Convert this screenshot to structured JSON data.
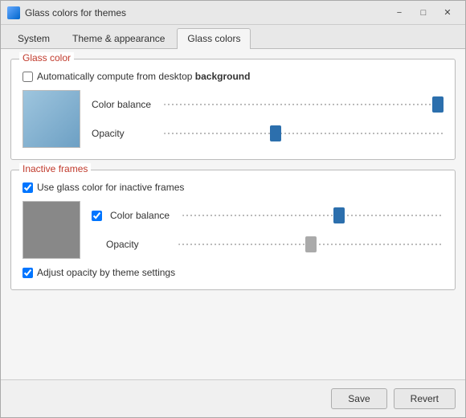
{
  "window": {
    "title": "Glass colors for themes",
    "icon": "app-icon"
  },
  "titlebar": {
    "minimize_label": "−",
    "maximize_label": "□",
    "close_label": "✕"
  },
  "tabs": [
    {
      "id": "system",
      "label": "System"
    },
    {
      "id": "theme",
      "label": "Theme & appearance"
    },
    {
      "id": "glass",
      "label": "Glass colors",
      "active": true
    }
  ],
  "glass_color_section": {
    "title": "Glass color",
    "auto_checkbox_label": "Automatically compute from desktop ",
    "auto_checkbox_bold": "background",
    "auto_checked": false,
    "color_balance_label": "Color balance",
    "opacity_label": "Opacity",
    "color_balance_value": 98,
    "opacity_value": 40,
    "preview_color": "#7bafd4"
  },
  "inactive_frames_section": {
    "title": "Inactive frames",
    "use_glass_label": "Use glass color for inactive frames",
    "use_glass_checked": true,
    "color_balance_label": "Color balance",
    "color_balance_checked": true,
    "opacity_label": "Opacity",
    "color_balance_value": 60,
    "opacity_value": 50,
    "adjust_opacity_label": "Adjust opacity by theme settings",
    "adjust_opacity_checked": true,
    "preview_color": "#888888"
  },
  "footer": {
    "save_label": "Save",
    "revert_label": "Revert"
  }
}
